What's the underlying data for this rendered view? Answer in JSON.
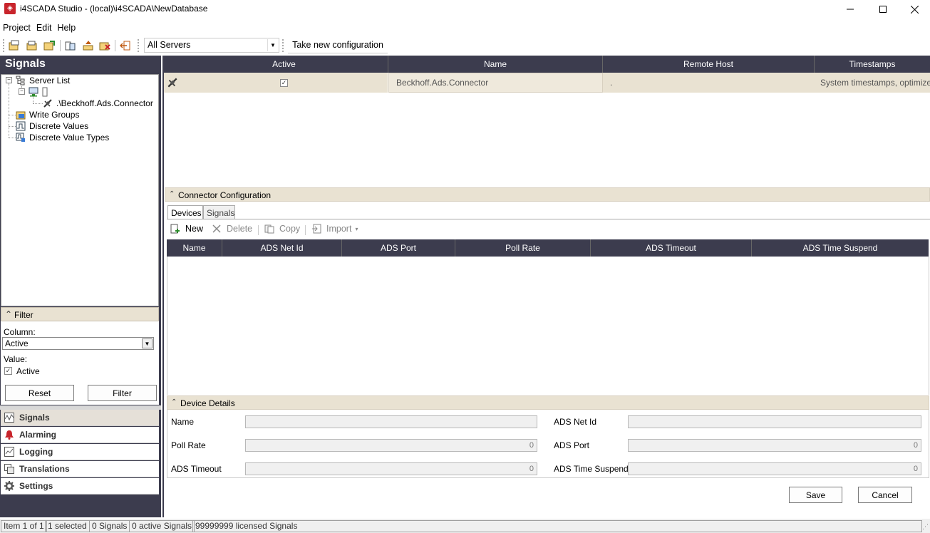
{
  "window": {
    "title": "i4SCADA Studio - (local)\\i4SCADA\\NewDatabase",
    "minimize": "—",
    "maximize": "☐",
    "close": "✕"
  },
  "menu": [
    "Project",
    "Edit",
    "Help"
  ],
  "toolbar": {
    "server_combo": "All Servers",
    "take_config": "Take new configuration"
  },
  "left_panel": {
    "title": "Signals",
    "tree": {
      "server_list": "Server List",
      "connector": ".\\Beckhoff.Ads.Connector",
      "write_groups": "Write Groups",
      "discrete_values": "Discrete Values",
      "discrete_value_types": "Discrete Value Types"
    },
    "filter": {
      "header": "Filter",
      "column_label": "Column:",
      "column_value": "Active",
      "value_label": "Value:",
      "value_check": "Active",
      "reset": "Reset",
      "filter": "Filter"
    },
    "nav": [
      {
        "label": "Signals",
        "icon": "signals-icon"
      },
      {
        "label": "Alarming",
        "icon": "bell-icon"
      },
      {
        "label": "Logging",
        "icon": "logging-icon"
      },
      {
        "label": "Translations",
        "icon": "translations-icon"
      },
      {
        "label": "Settings",
        "icon": "gear-icon"
      }
    ]
  },
  "connectors_grid": {
    "columns": [
      "Active",
      "Name",
      "Remote Host",
      "Timestamps"
    ],
    "rows": [
      {
        "active": true,
        "name": "Beckhoff.Ads.Connector",
        "remote_host": ".",
        "timestamps": "System timestamps, optimize"
      }
    ]
  },
  "connector_config": {
    "header": "Connector Configuration",
    "tabs": [
      "Devices",
      "Signals"
    ],
    "toolbar": {
      "new": "New",
      "delete": "Delete",
      "copy": "Copy",
      "import": "Import"
    },
    "columns": [
      "Name",
      "ADS Net Id",
      "ADS Port",
      "Poll Rate",
      "ADS Timeout",
      "ADS Time Suspend"
    ]
  },
  "device_details": {
    "header": "Device Details",
    "name_label": "Name",
    "poll_rate_label": "Poll Rate",
    "poll_rate_value": "0",
    "ads_timeout_label": "ADS Timeout",
    "ads_timeout_value": "0",
    "net_id_label": "ADS Net Id",
    "port_label": "ADS Port",
    "port_value": "0",
    "time_suspend_label": "ADS Time Suspend",
    "time_suspend_value": "0",
    "save": "Save",
    "cancel": "Cancel"
  },
  "status": [
    "Item 1 of 1",
    "1 selected",
    "0 Signals",
    "0 active Signals",
    "99999999 licensed Signals"
  ]
}
